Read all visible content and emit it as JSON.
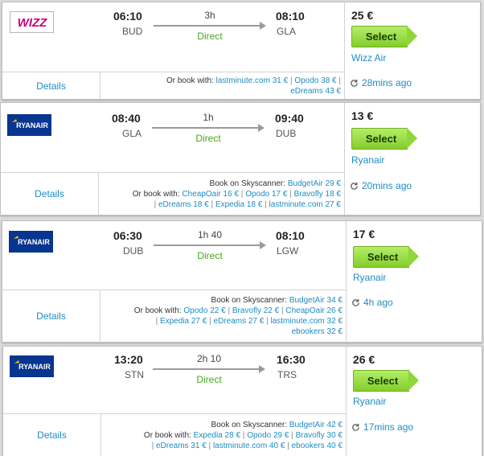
{
  "common": {
    "details_label": "Details",
    "direct_label": "Direct",
    "select_label": "Select"
  },
  "flights": [
    {
      "airline_logo": "wizzair-logo",
      "dep_time": "06:10",
      "dep_airport": "BUD",
      "duration": "3h",
      "arr_time": "08:10",
      "arr_airport": "GLA",
      "price": "25 €",
      "airline": "Wizz Air",
      "age": "28mins ago",
      "skyscanner": null,
      "or_book_prefix": "Or book with:",
      "partners": [
        "lastminute.com 31 €",
        "Opodo 38 €",
        "eDreams 43 €"
      ]
    },
    {
      "airline_logo": "ryanair-logo",
      "dep_time": "08:40",
      "dep_airport": "GLA",
      "duration": "1h",
      "arr_time": "09:40",
      "arr_airport": "DUB",
      "price": "13 €",
      "airline": "Ryanair",
      "age": "20mins ago",
      "skyscanner_prefix": "Book on Skyscanner:",
      "skyscanner": "BudgetAir 29 €",
      "or_book_prefix": "Or book with:",
      "partners": [
        "CheapOair 16 €",
        "Opodo 17 €",
        "Bravofly 18 €",
        "eDreams 18 €",
        "Expedia 18 €",
        "lastminute.com 27 €"
      ]
    },
    {
      "airline_logo": "ryanair-logo",
      "dep_time": "06:30",
      "dep_airport": "DUB",
      "duration": "1h 40",
      "arr_time": "08:10",
      "arr_airport": "LGW",
      "price": "17 €",
      "airline": "Ryanair",
      "age": "4h ago",
      "skyscanner_prefix": "Book on Skyscanner:",
      "skyscanner": "BudgetAir 34 €",
      "or_book_prefix": "Or book with:",
      "partners": [
        "Opodo 22 €",
        "Bravofly 22 €",
        "CheapOair 26 €",
        "Expedia 27 €",
        "eDreams 27 €",
        "lastminute.com 32 €",
        "ebookers 32 €"
      ]
    },
    {
      "airline_logo": "ryanair-logo",
      "dep_time": "13:20",
      "dep_airport": "STN",
      "duration": "2h 10",
      "arr_time": "16:30",
      "arr_airport": "TRS",
      "price": "26 €",
      "airline": "Ryanair",
      "age": "17mins ago",
      "skyscanner_prefix": "Book on Skyscanner:",
      "skyscanner": "BudgetAir 42 €",
      "or_book_prefix": "Or book with:",
      "partners": [
        "Expedia 28 €",
        "Opodo 29 €",
        "Bravofly 30 €",
        "eDreams 31 €",
        "lastminute.com 40 €",
        "ebookers 40 €"
      ]
    }
  ],
  "logos": {
    "wizzair": "WIZZ",
    "ryanair": "RYANAIR"
  },
  "colors": {
    "link": "#1d8cc4",
    "direct": "#4aa51f",
    "select_button": "#8fd63a",
    "ryanair_logo_bg": "#073590",
    "wizz_pink": "#c6007e"
  }
}
